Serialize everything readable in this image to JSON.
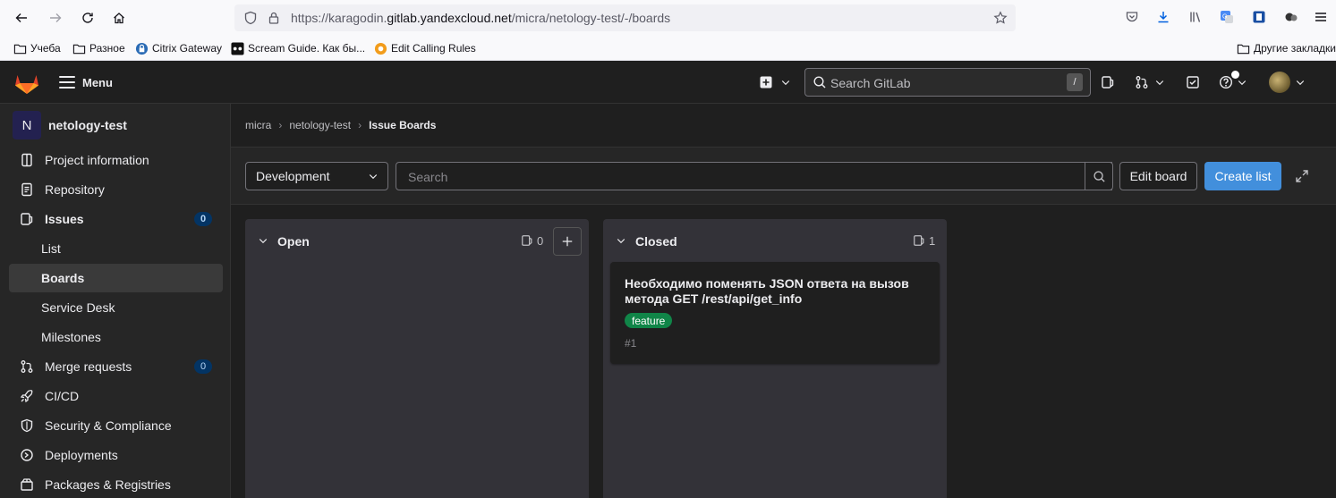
{
  "browser": {
    "url_prefix": "https://karagodin.",
    "url_host": "gitlab.yandexcloud.net",
    "url_path": "/micra/netology-test/-/boards",
    "bookmarks": [
      {
        "label": "Учеба",
        "icon": "folder-icon"
      },
      {
        "label": "Разное",
        "icon": "folder-icon"
      },
      {
        "label": "Citrix Gateway",
        "icon": "lock-icon"
      },
      {
        "label": "Scream Guide. Как бы...",
        "icon": "scream-icon"
      },
      {
        "label": "Edit Calling Rules",
        "icon": "globe-icon"
      }
    ],
    "other_bookmarks": "Другие закладки"
  },
  "topbar": {
    "menu_label": "Menu",
    "search_placeholder": "Search GitLab",
    "search_shortcut": "/"
  },
  "sidebar": {
    "project_initial": "N",
    "project_name": "netology-test",
    "items": [
      {
        "label": "Project information",
        "icon": "info-icon"
      },
      {
        "label": "Repository",
        "icon": "doc-icon"
      },
      {
        "label": "Issues",
        "icon": "issues-icon",
        "count": "0"
      },
      {
        "label": "List"
      },
      {
        "label": "Boards"
      },
      {
        "label": "Service Desk"
      },
      {
        "label": "Milestones"
      },
      {
        "label": "Merge requests",
        "icon": "merge-request-icon",
        "count": "0"
      },
      {
        "label": "CI/CD",
        "icon": "rocket-icon"
      },
      {
        "label": "Security & Compliance",
        "icon": "shield-icon"
      },
      {
        "label": "Deployments",
        "icon": "deployments-icon"
      },
      {
        "label": "Packages & Registries",
        "icon": "package-icon"
      }
    ]
  },
  "breadcrumb": {
    "items": [
      "micra",
      "netology-test",
      "Issue Boards"
    ]
  },
  "board": {
    "selected_board": "Development",
    "search_placeholder": "Search",
    "edit_label": "Edit board",
    "create_label": "Create list",
    "lists": [
      {
        "title": "Open",
        "count": "0",
        "cards": []
      },
      {
        "title": "Closed",
        "count": "1",
        "cards": [
          {
            "title": "Необходимо поменять JSON ответа на вызов метода GET /rest/api/get_info",
            "label": "feature",
            "ref": "#1"
          }
        ]
      }
    ]
  },
  "colors": {
    "accent": "#428fdc",
    "label_feature": "#108548",
    "background": "#1f1f1f"
  }
}
